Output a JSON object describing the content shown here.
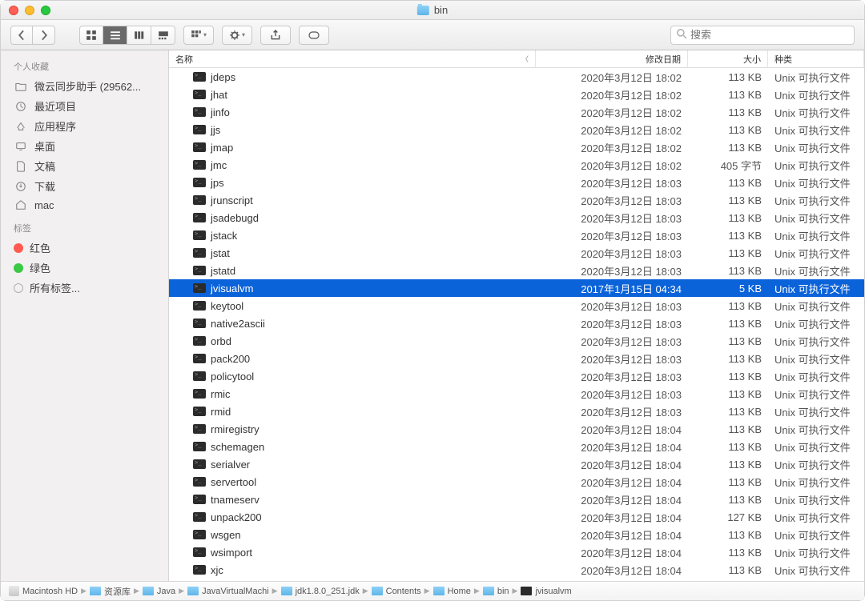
{
  "window": {
    "title": "bin"
  },
  "search": {
    "placeholder": "搜索"
  },
  "sidebar": {
    "favorites_label": "个人收藏",
    "tags_label": "标签",
    "items": [
      {
        "icon": "folder",
        "label": "微云同步助手 (29562..."
      },
      {
        "icon": "clock",
        "label": "最近项目"
      },
      {
        "icon": "apps",
        "label": "应用程序"
      },
      {
        "icon": "desktop",
        "label": "桌面"
      },
      {
        "icon": "doc",
        "label": "文稿"
      },
      {
        "icon": "download",
        "label": "下载"
      },
      {
        "icon": "home",
        "label": "mac"
      }
    ],
    "tags": [
      {
        "color": "#ff5a50",
        "label": "红色"
      },
      {
        "color": "#3ac845",
        "label": "绿色"
      },
      {
        "color": "none",
        "label": "所有标签..."
      }
    ]
  },
  "columns": {
    "name": "名称",
    "date": "修改日期",
    "size": "大小",
    "kind": "种类"
  },
  "files": [
    {
      "name": "jdeps",
      "date": "2020年3月12日 18:02",
      "size": "113 KB",
      "kind": "Unix 可执行文件",
      "sel": false
    },
    {
      "name": "jhat",
      "date": "2020年3月12日 18:02",
      "size": "113 KB",
      "kind": "Unix 可执行文件",
      "sel": false
    },
    {
      "name": "jinfo",
      "date": "2020年3月12日 18:02",
      "size": "113 KB",
      "kind": "Unix 可执行文件",
      "sel": false
    },
    {
      "name": "jjs",
      "date": "2020年3月12日 18:02",
      "size": "113 KB",
      "kind": "Unix 可执行文件",
      "sel": false
    },
    {
      "name": "jmap",
      "date": "2020年3月12日 18:02",
      "size": "113 KB",
      "kind": "Unix 可执行文件",
      "sel": false
    },
    {
      "name": "jmc",
      "date": "2020年3月12日 18:02",
      "size": "405 字节",
      "kind": "Unix 可执行文件",
      "sel": false
    },
    {
      "name": "jps",
      "date": "2020年3月12日 18:03",
      "size": "113 KB",
      "kind": "Unix 可执行文件",
      "sel": false
    },
    {
      "name": "jrunscript",
      "date": "2020年3月12日 18:03",
      "size": "113 KB",
      "kind": "Unix 可执行文件",
      "sel": false
    },
    {
      "name": "jsadebugd",
      "date": "2020年3月12日 18:03",
      "size": "113 KB",
      "kind": "Unix 可执行文件",
      "sel": false
    },
    {
      "name": "jstack",
      "date": "2020年3月12日 18:03",
      "size": "113 KB",
      "kind": "Unix 可执行文件",
      "sel": false
    },
    {
      "name": "jstat",
      "date": "2020年3月12日 18:03",
      "size": "113 KB",
      "kind": "Unix 可执行文件",
      "sel": false
    },
    {
      "name": "jstatd",
      "date": "2020年3月12日 18:03",
      "size": "113 KB",
      "kind": "Unix 可执行文件",
      "sel": false
    },
    {
      "name": "jvisualvm",
      "date": "2017年1月15日 04:34",
      "size": "5 KB",
      "kind": "Unix 可执行文件",
      "sel": true
    },
    {
      "name": "keytool",
      "date": "2020年3月12日 18:03",
      "size": "113 KB",
      "kind": "Unix 可执行文件",
      "sel": false
    },
    {
      "name": "native2ascii",
      "date": "2020年3月12日 18:03",
      "size": "113 KB",
      "kind": "Unix 可执行文件",
      "sel": false
    },
    {
      "name": "orbd",
      "date": "2020年3月12日 18:03",
      "size": "113 KB",
      "kind": "Unix 可执行文件",
      "sel": false
    },
    {
      "name": "pack200",
      "date": "2020年3月12日 18:03",
      "size": "113 KB",
      "kind": "Unix 可执行文件",
      "sel": false
    },
    {
      "name": "policytool",
      "date": "2020年3月12日 18:03",
      "size": "113 KB",
      "kind": "Unix 可执行文件",
      "sel": false
    },
    {
      "name": "rmic",
      "date": "2020年3月12日 18:03",
      "size": "113 KB",
      "kind": "Unix 可执行文件",
      "sel": false
    },
    {
      "name": "rmid",
      "date": "2020年3月12日 18:03",
      "size": "113 KB",
      "kind": "Unix 可执行文件",
      "sel": false
    },
    {
      "name": "rmiregistry",
      "date": "2020年3月12日 18:04",
      "size": "113 KB",
      "kind": "Unix 可执行文件",
      "sel": false
    },
    {
      "name": "schemagen",
      "date": "2020年3月12日 18:04",
      "size": "113 KB",
      "kind": "Unix 可执行文件",
      "sel": false
    },
    {
      "name": "serialver",
      "date": "2020年3月12日 18:04",
      "size": "113 KB",
      "kind": "Unix 可执行文件",
      "sel": false
    },
    {
      "name": "servertool",
      "date": "2020年3月12日 18:04",
      "size": "113 KB",
      "kind": "Unix 可执行文件",
      "sel": false
    },
    {
      "name": "tnameserv",
      "date": "2020年3月12日 18:04",
      "size": "113 KB",
      "kind": "Unix 可执行文件",
      "sel": false
    },
    {
      "name": "unpack200",
      "date": "2020年3月12日 18:04",
      "size": "127 KB",
      "kind": "Unix 可执行文件",
      "sel": false
    },
    {
      "name": "wsgen",
      "date": "2020年3月12日 18:04",
      "size": "113 KB",
      "kind": "Unix 可执行文件",
      "sel": false
    },
    {
      "name": "wsimport",
      "date": "2020年3月12日 18:04",
      "size": "113 KB",
      "kind": "Unix 可执行文件",
      "sel": false
    },
    {
      "name": "xjc",
      "date": "2020年3月12日 18:04",
      "size": "113 KB",
      "kind": "Unix 可执行文件",
      "sel": false
    }
  ],
  "path": [
    {
      "icon": "disk",
      "label": "Macintosh HD"
    },
    {
      "icon": "folder",
      "label": "资源库"
    },
    {
      "icon": "folder",
      "label": "Java"
    },
    {
      "icon": "folder",
      "label": "JavaVirtualMachi"
    },
    {
      "icon": "folder",
      "label": "jdk1.8.0_251.jdk"
    },
    {
      "icon": "folder",
      "label": "Contents"
    },
    {
      "icon": "folder",
      "label": "Home"
    },
    {
      "icon": "folder",
      "label": "bin"
    },
    {
      "icon": "exec",
      "label": "jvisualvm"
    }
  ]
}
